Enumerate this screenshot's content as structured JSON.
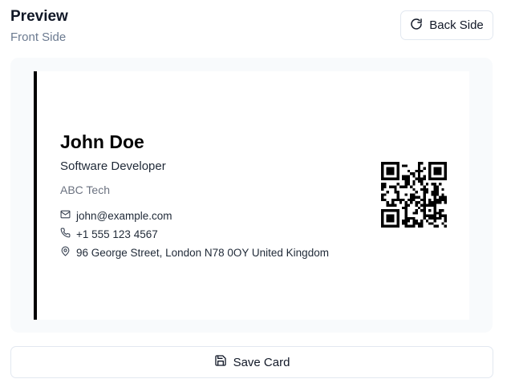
{
  "header": {
    "title": "Preview",
    "subtitle": "Front Side",
    "flip_button_label": "Back Side",
    "flip_icon": "rotate-cw-icon"
  },
  "card": {
    "name": "John Doe",
    "title": "Software Developer",
    "company": "ABC Tech",
    "accent_color": "#000000",
    "contacts": [
      {
        "icon": "mail-icon",
        "value": "john@example.com"
      },
      {
        "icon": "phone-icon",
        "value": "+1 555 123 4567"
      },
      {
        "icon": "map-pin-icon",
        "value": "96 George Street, London N78 0OY United Kingdom"
      }
    ]
  },
  "footer": {
    "save_label": "Save Card",
    "save_icon": "save-icon"
  }
}
